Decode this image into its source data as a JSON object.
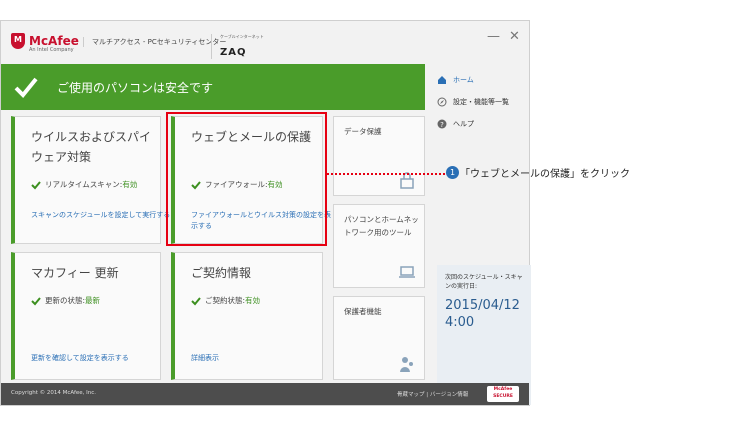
{
  "header": {
    "logo_text": "McAfee",
    "logo_sub": "An Intel Company",
    "product_name": "マルチアクセス - PCセキュリティセンター",
    "zaq_small": "ケーブルインターネット",
    "zaq": "ZAQ",
    "minimize": "—",
    "close": "✕"
  },
  "banner": {
    "text": "ご使用のパソコンは安全です"
  },
  "tiles": {
    "virus": {
      "title": "ウイルスおよびスパイウェア対策",
      "status_label": "リアルタイムスキャン: ",
      "status_value": "有効",
      "link": "スキャンのスケジュールを設定して実行する"
    },
    "web": {
      "title": "ウェブとメールの保護",
      "status_label": "ファイアウォール: ",
      "status_value": "有効",
      "link": "ファイアウォールとウイルス対策の設定を表示する"
    },
    "update": {
      "title": "マカフィー 更新",
      "status_label": "更新の状態: ",
      "status_value": "最新",
      "link": "更新を確認して設定を表示する"
    },
    "contract": {
      "title": "ご契約情報",
      "status_label": "ご契約状態: ",
      "status_value": "有効",
      "link": "詳細表示"
    }
  },
  "side_tiles": [
    {
      "title": "データ保護",
      "icon": "lock-icon"
    },
    {
      "title": "パソコンとホームネットワーク用のツール",
      "icon": "laptop-icon"
    },
    {
      "title": "保護者機能",
      "icon": "parent-icon"
    }
  ],
  "nav": [
    {
      "label": "ホーム",
      "icon": "home-icon"
    },
    {
      "label": "設定・機能等一覧",
      "icon": "compass-icon"
    },
    {
      "label": "ヘルプ",
      "icon": "help-icon"
    }
  ],
  "schedule": {
    "label": "次回のスケジュール・スキャンの実行日:",
    "date": "2015/04/12",
    "time": "4:00"
  },
  "footer": {
    "copyright": "Copyright © 2014 McAfee, Inc.",
    "links": "骨蔵マップ | バージョン情報",
    "secure_top": "McAfee",
    "secure_bottom": "SECURE"
  },
  "annotation": {
    "number": "1",
    "text": "「ウェブとメールの保護」をクリック"
  },
  "colors": {
    "green": "#4a9c2a",
    "red": "#e60012",
    "link": "#2a6fb5"
  }
}
